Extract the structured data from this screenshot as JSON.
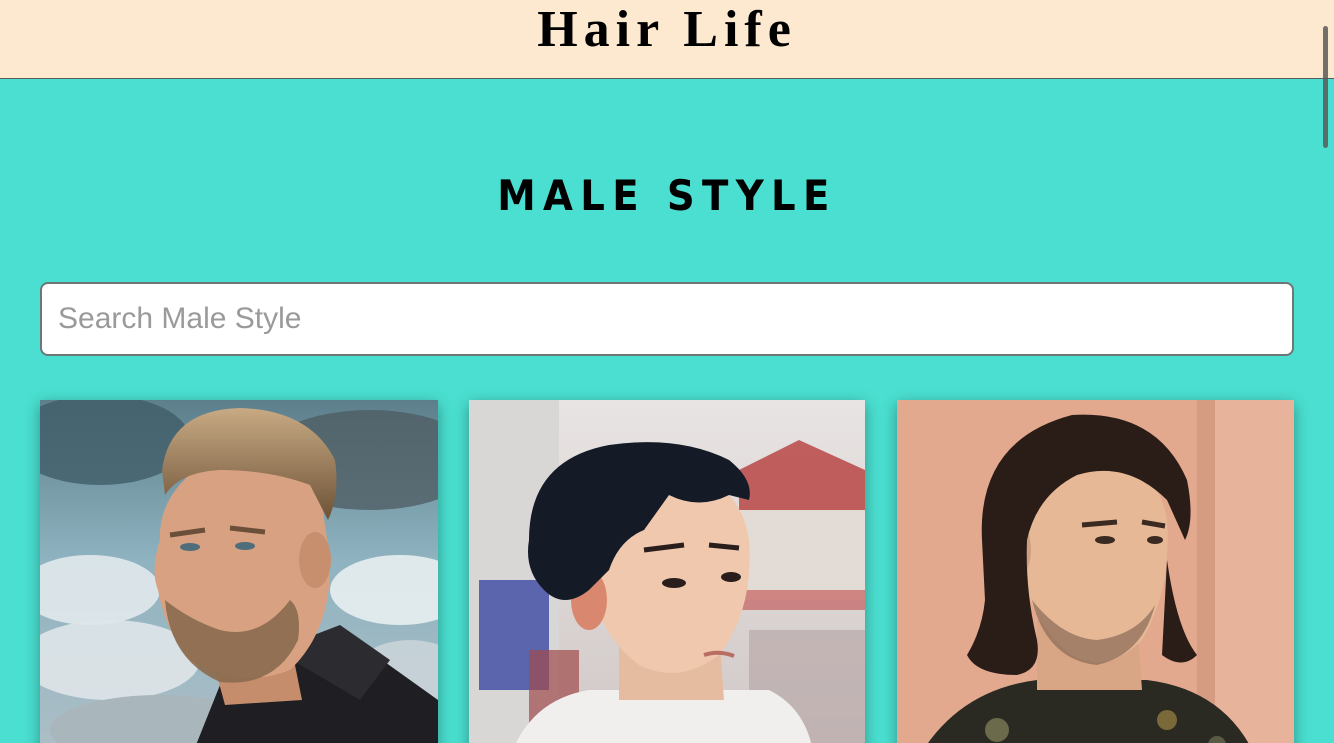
{
  "header": {
    "brand": "Hair Life",
    "background_color": "#fde9cf"
  },
  "page": {
    "background_color": "#4adfd0",
    "section_title": "MALE STYLE"
  },
  "search": {
    "placeholder": "Search Male Style",
    "value": ""
  },
  "gallery": {
    "cards": [
      {
        "id": "style-1",
        "image": "man with slicked-back undercut and beard, cloudy sky"
      },
      {
        "id": "style-2",
        "image": "man with black textured two-block cut, blurred street"
      },
      {
        "id": "style-3",
        "image": "man with shoulder-length dark hair, peach wall"
      }
    ]
  }
}
